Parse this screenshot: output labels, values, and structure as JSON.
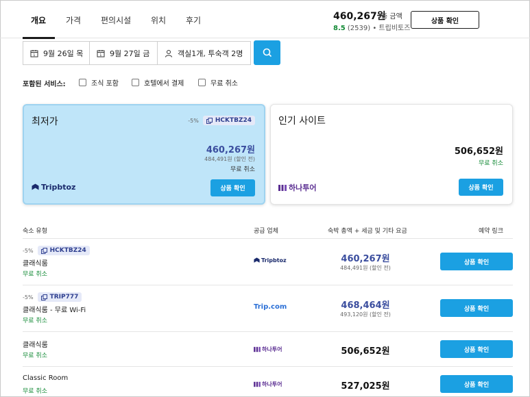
{
  "nav": {
    "tabs": [
      {
        "label": "개요"
      },
      {
        "label": "가격"
      },
      {
        "label": "편의시설"
      },
      {
        "label": "위치"
      },
      {
        "label": "후기"
      }
    ],
    "total_price": "460,267원",
    "total_label": "총 금액",
    "rating_score": "8.5",
    "rating_rest": "(2539) • 트립비토즈",
    "view_button": "상품 확인"
  },
  "search": {
    "checkin": "9월 26일 목",
    "checkout": "9월 27일 금",
    "guests": "객실1개, 투숙객 2명"
  },
  "services": {
    "label": "포함된 서비스:",
    "options": [
      "조식 포함",
      "호텔에서 결제",
      "무료 취소"
    ]
  },
  "cards": {
    "best": {
      "title": "최저가",
      "discount": "-5%",
      "coupon": "HCKTBZ24",
      "price": "460,267원",
      "original": "484,491원 (할인 전)",
      "cancel": "무료 취소",
      "button": "상품 확인",
      "provider": "Tripbtoz"
    },
    "popular": {
      "title": "인기 사이트",
      "price": "506,652원",
      "cancel": "무료 취소",
      "button": "상품 확인",
      "provider": "하나투어"
    }
  },
  "table": {
    "headers": {
      "room": "숙소 유형",
      "supplier": "공급 업체",
      "price": "숙박 총액 + 세금 및 기타 요금",
      "link": "예약 링크"
    },
    "rows": [
      {
        "discount": "-5%",
        "coupon": "HCKTBZ24",
        "name": "클래식룸",
        "cancel": "무료 취소",
        "supplier": "Tripbtoz",
        "price": "460,267원",
        "original": "484,491원 (할인 전)",
        "button": "상품 확인"
      },
      {
        "discount": "-5%",
        "coupon": "TRIP777",
        "name": "클래식룸 - 무료 Wi-Fi",
        "cancel": "무료 취소",
        "supplier": "Trip.com",
        "price": "468,464원",
        "original": "493,120원 (할인 전)",
        "button": "상품 확인"
      },
      {
        "name": "클래식룸",
        "cancel": "무료 취소",
        "supplier": "하나투어",
        "price": "506,652원",
        "button": "상품 확인"
      },
      {
        "name": "Classic Room",
        "cancel": "무료 취소",
        "supplier": "하나투어",
        "price": "527,025원",
        "button": "상품 확인"
      }
    ]
  },
  "colors": {
    "accent": "#1ba0e2",
    "best_card_bg": "#bfe5f9",
    "discount_price": "#3a4d9e",
    "free_cancel": "#138a36",
    "tripbtoz": "#1a2a6c",
    "tripcom": "#2a6fd6",
    "hanatour": "#5a2d91"
  }
}
